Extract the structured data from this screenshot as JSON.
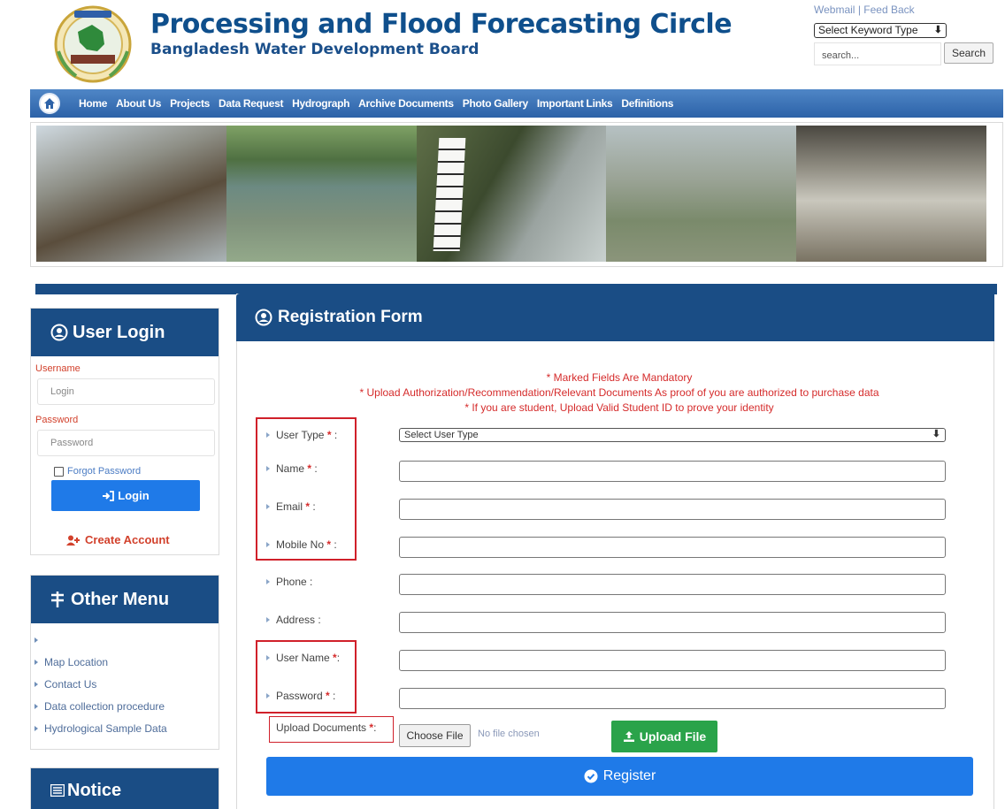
{
  "header": {
    "title": "Processing and Flood Forecasting Circle",
    "subtitle": "Bangladesh Water Development Board",
    "top_links": {
      "webmail": "Webmail",
      "separator": "|",
      "feedback": "Feed Back"
    },
    "keyword_select": "Select Keyword Type",
    "search_placeholder": "search...",
    "search_button": "Search"
  },
  "nav": {
    "items": [
      "Home",
      "About Us",
      "Projects",
      "Data Request",
      "Hydrograph",
      "Archive Documents",
      "Photo Gallery",
      "Important Links",
      "Definitions"
    ]
  },
  "sidebar": {
    "login": {
      "title": "User Login",
      "username_label": "Username",
      "username_placeholder": "Login",
      "password_label": "Password",
      "password_placeholder": "Password",
      "forgot": "Forgot Password",
      "login_button": "Login",
      "create_account": "Create Account"
    },
    "other_menu": {
      "title": "Other Menu",
      "items": [
        "",
        "Map Location",
        "Contact Us",
        "Data collection procedure",
        "Hydrological Sample Data"
      ]
    },
    "notice": {
      "title": "Notice"
    }
  },
  "form": {
    "title": "Registration Form",
    "notes": [
      "* Marked Fields Are Mandatory",
      "* Upload Authorization/Recommendation/Relevant Documents As proof of you are authorized to purchase data",
      "* If you are student, Upload Valid Student ID to prove your identity"
    ],
    "fields": {
      "user_type": {
        "label": "User Type",
        "req": "*",
        "suffix": " :",
        "value": "Select User Type"
      },
      "name": {
        "label": "Name",
        "req": "*",
        "suffix": " :"
      },
      "email": {
        "label": "Email",
        "req": "*",
        "suffix": " :"
      },
      "mobile": {
        "label": "Mobile No",
        "req": "*",
        "suffix": " :"
      },
      "phone": {
        "label": "Phone :"
      },
      "address": {
        "label": "Address :"
      },
      "username": {
        "label": "User Name",
        "req": "*",
        "suffix": ":"
      },
      "password": {
        "label": "Password",
        "req": "*",
        "suffix": " :"
      }
    },
    "upload": {
      "label": "Upload Documents",
      "req": "*",
      "suffix": ":",
      "choose_button": "Choose File",
      "status": "No file chosen",
      "upload_button": "Upload File"
    },
    "register_button": "Register"
  },
  "colors": {
    "brand_blue": "#1a4d85",
    "button_blue": "#1f7ae8",
    "upload_green": "#2aa34a",
    "required_red": "#d52b2b"
  }
}
